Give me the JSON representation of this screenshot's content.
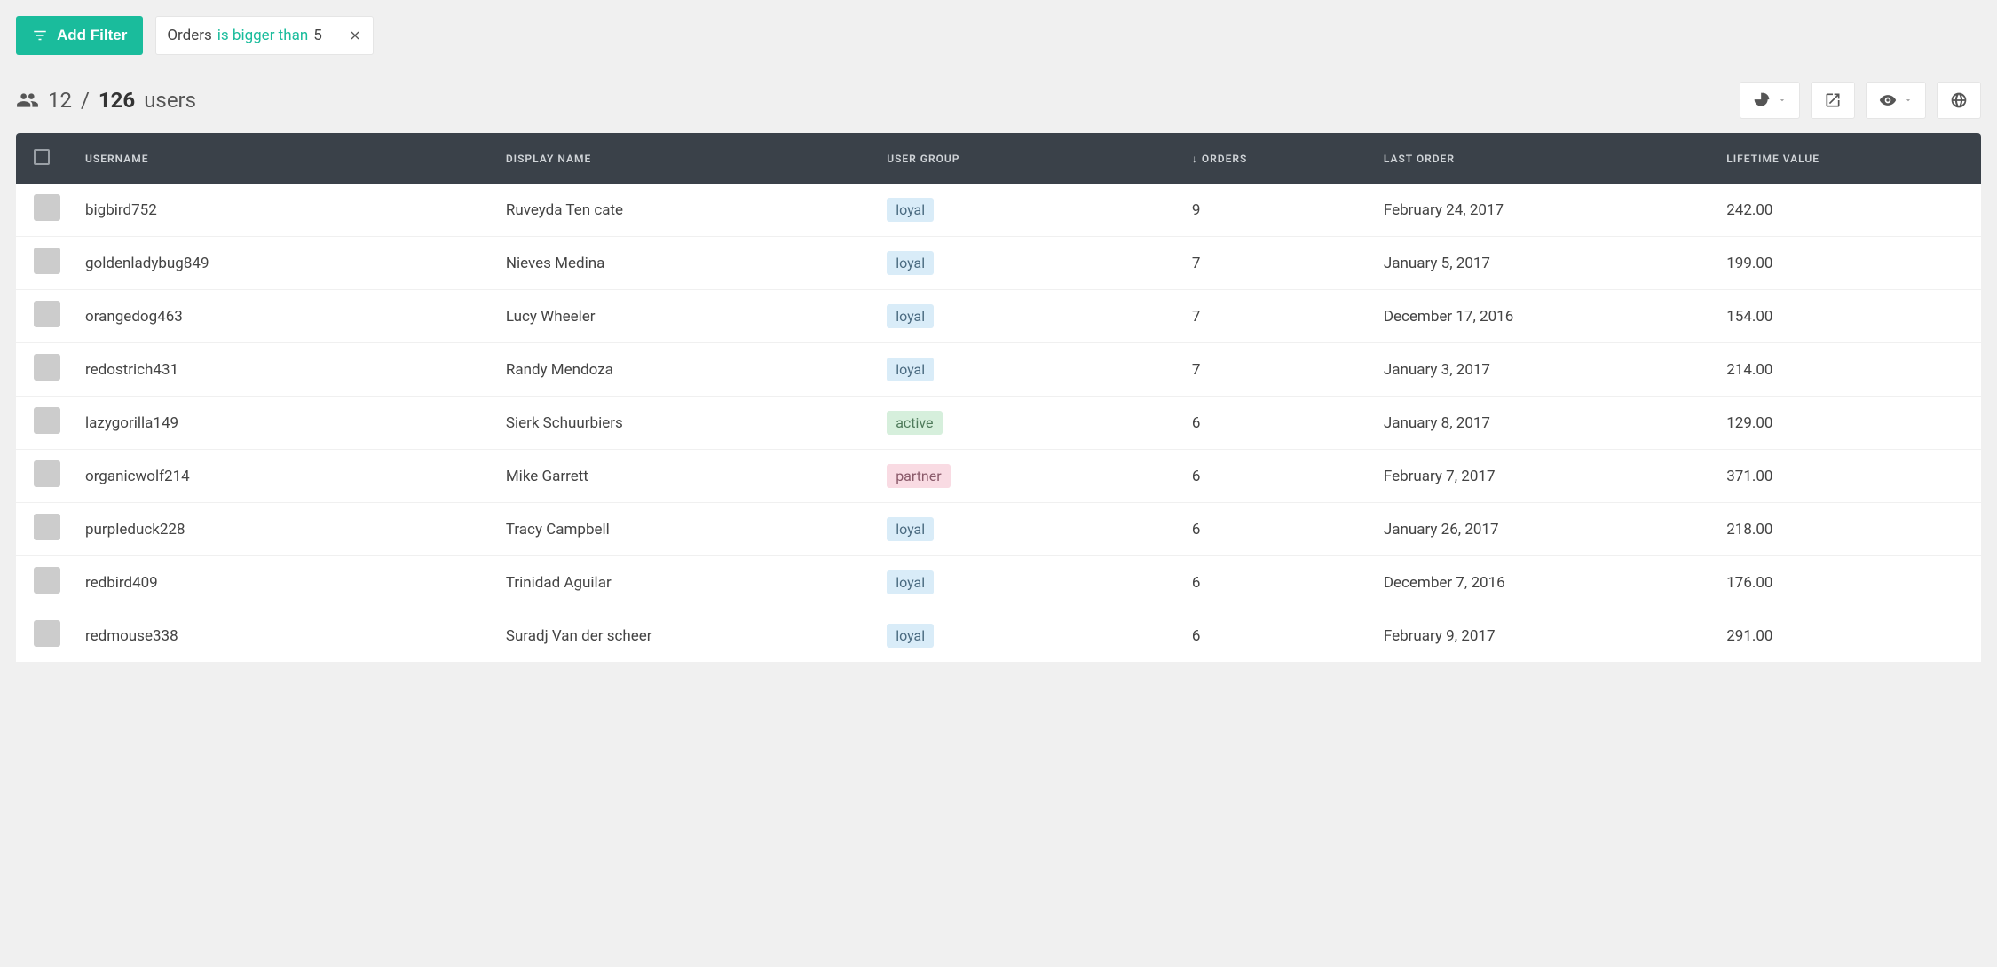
{
  "filters": {
    "add_label": "Add Filter",
    "chip_field": "Orders",
    "chip_op": "is bigger than",
    "chip_value": "5"
  },
  "summary": {
    "shown": "12",
    "sep": "/",
    "total": "126",
    "unit": "users"
  },
  "table": {
    "headers": {
      "username": "USERNAME",
      "display_name": "DISPLAY NAME",
      "user_group": "USER GROUP",
      "orders": "ORDERS",
      "last_order": "LAST ORDER",
      "lifetime_value": "LIFETIME VALUE",
      "sort_indicator": "↓"
    },
    "rows": [
      {
        "username": "bigbird752",
        "display_name": "Ruveyda Ten cate",
        "group": "loyal",
        "orders": "9",
        "last_order": "February 24, 2017",
        "ltv": "242.00"
      },
      {
        "username": "goldenladybug849",
        "display_name": "Nieves Medina",
        "group": "loyal",
        "orders": "7",
        "last_order": "January 5, 2017",
        "ltv": "199.00"
      },
      {
        "username": "orangedog463",
        "display_name": "Lucy Wheeler",
        "group": "loyal",
        "orders": "7",
        "last_order": "December 17, 2016",
        "ltv": "154.00"
      },
      {
        "username": "redostrich431",
        "display_name": "Randy Mendoza",
        "group": "loyal",
        "orders": "7",
        "last_order": "January 3, 2017",
        "ltv": "214.00"
      },
      {
        "username": "lazygorilla149",
        "display_name": "Sierk Schuurbiers",
        "group": "active",
        "orders": "6",
        "last_order": "January 8, 2017",
        "ltv": "129.00"
      },
      {
        "username": "organicwolf214",
        "display_name": "Mike Garrett",
        "group": "partner",
        "orders": "6",
        "last_order": "February 7, 2017",
        "ltv": "371.00"
      },
      {
        "username": "purpleduck228",
        "display_name": "Tracy Campbell",
        "group": "loyal",
        "orders": "6",
        "last_order": "January 26, 2017",
        "ltv": "218.00"
      },
      {
        "username": "redbird409",
        "display_name": "Trinidad Aguilar",
        "group": "loyal",
        "orders": "6",
        "last_order": "December 7, 2016",
        "ltv": "176.00"
      },
      {
        "username": "redmouse338",
        "display_name": "Suradj Van der scheer",
        "group": "loyal",
        "orders": "6",
        "last_order": "February 9, 2017",
        "ltv": "291.00"
      }
    ]
  }
}
